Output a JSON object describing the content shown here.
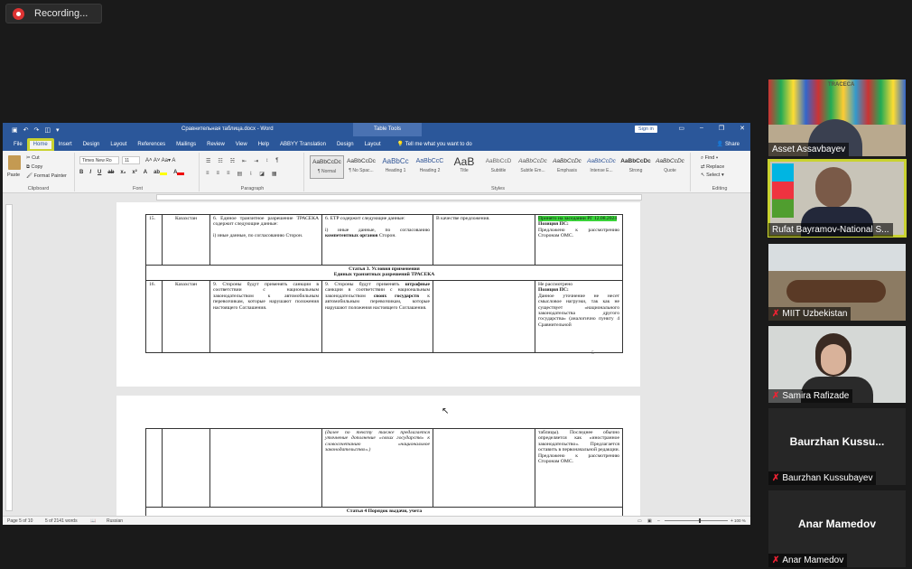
{
  "recording": {
    "label": "Recording..."
  },
  "word": {
    "title": "Сравнительная таблица.docx - Word",
    "table_tools": "Table Tools",
    "sign_in": "Sign in",
    "tabs": [
      "File",
      "Home",
      "Insert",
      "Design",
      "Layout",
      "References",
      "Mailings",
      "Review",
      "View",
      "Help",
      "ABBYY Translation",
      "Design",
      "Layout"
    ],
    "tell_me": "Tell me what you want to do",
    "share": "Share",
    "clipboard": {
      "paste": "Paste",
      "cut": "Cut",
      "copy": "Copy",
      "format_painter": "Format Painter",
      "label": "Clipboard"
    },
    "font": {
      "name": "Times New Ro",
      "size": "11",
      "label": "Font"
    },
    "paragraph_label": "Paragraph",
    "styles": [
      {
        "preview": "AaBbCcDc",
        "name": "¶ Normal"
      },
      {
        "preview": "AaBbCcDc",
        "name": "¶ No Spac..."
      },
      {
        "preview": "AaBbCc",
        "name": "Heading 1"
      },
      {
        "preview": "AaBbCcC",
        "name": "Heading 2"
      },
      {
        "preview": "AaB",
        "name": "Title"
      },
      {
        "preview": "AaBbCcD",
        "name": "Subtitle"
      },
      {
        "preview": "AaBbCcDc",
        "name": "Subtle Em..."
      },
      {
        "preview": "AaBbCcDc",
        "name": "Emphasis"
      },
      {
        "preview": "AaBbCcDc",
        "name": "Intense E..."
      },
      {
        "preview": "AaBbCcDc",
        "name": "Strong"
      },
      {
        "preview": "AaBbCcDc",
        "name": "Quote"
      }
    ],
    "styles_label": "Styles",
    "editing": {
      "find": "Find",
      "replace": "Replace",
      "select": "Select",
      "label": "Editing"
    },
    "status": {
      "page": "Page 5 of 10",
      "words": "5 of 2141 words",
      "language": "Russian",
      "zoom": "100 %"
    }
  },
  "doc": {
    "row15": {
      "num": "15.",
      "country": "Казахстан",
      "c1": "6. Единое транзитное разрешение ТРАСЕКА содержит следующие данные:",
      "c1b": "i) иные данные, по согласованию Сторон.",
      "c2": "6. ЕТР содержит следующие данные:",
      "c2b_pre": "i) иные данные, по согласованию ",
      "c2b_bold": "компетентных органов",
      "c2b_post": " Сторон.",
      "c3": "В качестве предложения.",
      "c5_hl": "Принято на заседании РГ 12.08.2024",
      "c5_pos": "Позиция ПС:",
      "c5_text": "Предложено к рассмотрению Сторонам ОМС."
    },
    "article3": {
      "line1": "Статья 3. Условия применения",
      "line2": "Единых транзитных разрешений ТРАСЕКА"
    },
    "row16": {
      "num": "16.",
      "country": "Казахстан",
      "c1": "9. Стороны будут применять санкции в соответствии с национальным законодательством к автомобильным перевозчикам, которые нарушают положения настоящего Соглашения.",
      "c2_pre": "9. Стороны будут применять ",
      "c2_bold1": "штрафные",
      "c2_mid1": " санкции в соответствии с национальным законодательством ",
      "c2_bold2": "своих государств",
      "c2_post": " к автомобильным перевозчикам, которые нарушают положения настоящего Соглашения.",
      "c5_a": "Не рассмотрено",
      "c5_pos": "Позиция ПС:",
      "c5_text": "Данное уточнение не несет смысловое нагрузки, так как не существует «национального законодательства другого государства» (аналогично пункту 4 Сравнительной"
    },
    "page_number": "5",
    "cont": {
      "c2_ital": "(далее по тексту также предлагается уточнение дополнение «своих государств» к словосочетанию «национальное законодательство».)",
      "c5_text": "таблицы). Последнее обычно определяется как «иностранное законодательство». Предлагается оставить в первоначальной редакции. Предложено к рассмотрению Сторонам ОМС."
    },
    "article4": "Статья 4 Порядок выдачи, учета"
  },
  "participants": [
    {
      "name": "Asset Assavbayev",
      "muted": false,
      "video": true
    },
    {
      "name": "Rufat Bayramov-National S...",
      "muted": false,
      "video": true,
      "active": true
    },
    {
      "name": "MIIT Uzbekistan",
      "muted": true,
      "video": true
    },
    {
      "name": "Samira Rafizade",
      "muted": true,
      "video": true
    },
    {
      "name": "Baurzhan Kussubayev",
      "big": "Baurzhan  Kussu...",
      "muted": true,
      "video": false
    },
    {
      "name": "Anar Mamedov",
      "big": "Anar Mamedov",
      "muted": true,
      "video": false
    }
  ],
  "colors": {
    "word_blue": "#2b579a",
    "highlight": "#39d339",
    "active_speaker": "#c9d230",
    "mic_muted": "#e23"
  }
}
